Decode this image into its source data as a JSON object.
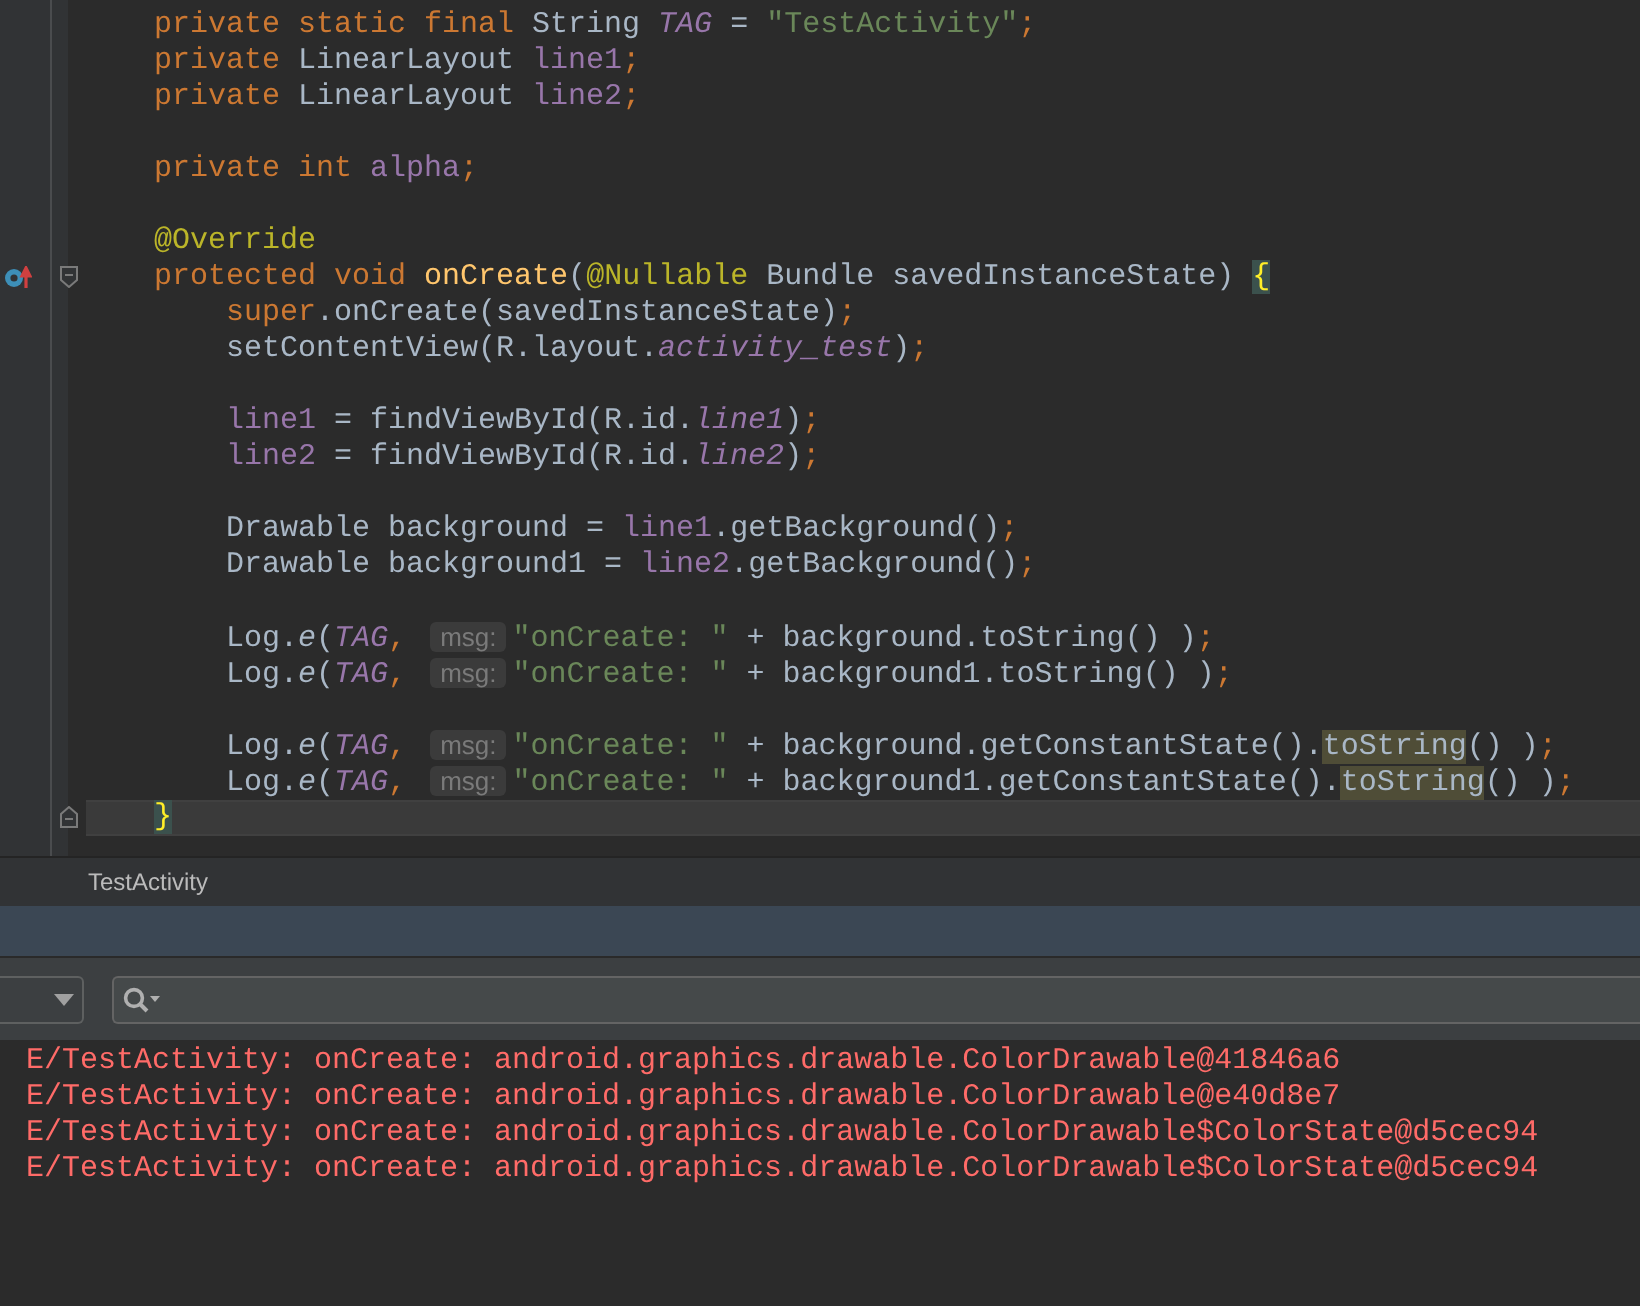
{
  "editor": {
    "lines": [
      {
        "kind": "code",
        "current": false,
        "tokens": [
          {
            "kind": "kw",
            "text": "private static final "
          },
          {
            "kind": "plain",
            "text": "String "
          },
          {
            "kind": "static",
            "text": "TAG"
          },
          {
            "kind": "plain",
            "text": " = "
          },
          {
            "kind": "str",
            "text": "\"TestActivity\""
          },
          {
            "kind": "kw",
            "text": ";"
          }
        ]
      },
      {
        "kind": "code",
        "current": false,
        "tokens": [
          {
            "kind": "kw",
            "text": "private "
          },
          {
            "kind": "plain",
            "text": "LinearLayout "
          },
          {
            "kind": "field",
            "text": "line1"
          },
          {
            "kind": "kw",
            "text": ";"
          }
        ]
      },
      {
        "kind": "code",
        "current": false,
        "tokens": [
          {
            "kind": "kw",
            "text": "private "
          },
          {
            "kind": "plain",
            "text": "LinearLayout "
          },
          {
            "kind": "field",
            "text": "line2"
          },
          {
            "kind": "kw",
            "text": ";"
          }
        ]
      },
      {
        "kind": "blank",
        "current": false
      },
      {
        "kind": "code",
        "current": false,
        "tokens": [
          {
            "kind": "kw",
            "text": "private int "
          },
          {
            "kind": "field",
            "text": "alpha"
          },
          {
            "kind": "kw",
            "text": ";"
          }
        ]
      },
      {
        "kind": "blank",
        "current": false
      },
      {
        "kind": "code",
        "current": false,
        "tokens": [
          {
            "kind": "ann",
            "text": "@Override"
          }
        ]
      },
      {
        "kind": "method_start",
        "current": false,
        "tokens": [
          {
            "kind": "kw",
            "text": "protected void "
          },
          {
            "kind": "decl",
            "text": "onCreate"
          },
          {
            "kind": "plain",
            "text": "("
          },
          {
            "kind": "ann",
            "text": "@Nullable"
          },
          {
            "kind": "plain",
            "text": " Bundle savedInstanceState) "
          },
          {
            "kind": "brace",
            "text": "{"
          }
        ]
      },
      {
        "kind": "code",
        "current": false,
        "tokens": [
          {
            "kind": "kw",
            "text": "    super"
          },
          {
            "kind": "plain",
            "text": ".onCreate(savedInstanceState)"
          },
          {
            "kind": "kw",
            "text": ";"
          }
        ]
      },
      {
        "kind": "code",
        "current": false,
        "tokens": [
          {
            "kind": "plain",
            "text": "    setContentView(R.layout."
          },
          {
            "kind": "static",
            "text": "activity_test"
          },
          {
            "kind": "plain",
            "text": ")"
          },
          {
            "kind": "kw",
            "text": ";"
          }
        ]
      },
      {
        "kind": "blank",
        "current": false
      },
      {
        "kind": "code",
        "current": false,
        "tokens": [
          {
            "kind": "field",
            "text": "    line1"
          },
          {
            "kind": "plain",
            "text": " = findViewById(R.id."
          },
          {
            "kind": "static",
            "text": "line1"
          },
          {
            "kind": "plain",
            "text": ")"
          },
          {
            "kind": "kw",
            "text": ";"
          }
        ]
      },
      {
        "kind": "code",
        "current": false,
        "tokens": [
          {
            "kind": "field",
            "text": "    line2"
          },
          {
            "kind": "plain",
            "text": " = findViewById(R.id."
          },
          {
            "kind": "static",
            "text": "line2"
          },
          {
            "kind": "plain",
            "text": ")"
          },
          {
            "kind": "kw",
            "text": ";"
          }
        ]
      },
      {
        "kind": "blank",
        "current": false
      },
      {
        "kind": "code",
        "current": false,
        "tokens": [
          {
            "kind": "plain",
            "text": "    Drawable background = "
          },
          {
            "kind": "field",
            "text": "line1"
          },
          {
            "kind": "plain",
            "text": ".getBackground()"
          },
          {
            "kind": "kw",
            "text": ";"
          }
        ]
      },
      {
        "kind": "code",
        "current": false,
        "tokens": [
          {
            "kind": "plain",
            "text": "    Drawable background1 = "
          },
          {
            "kind": "field",
            "text": "line2"
          },
          {
            "kind": "plain",
            "text": ".getBackground()"
          },
          {
            "kind": "kw",
            "text": ";"
          }
        ]
      },
      {
        "kind": "blank",
        "current": false
      },
      {
        "kind": "code",
        "current": false,
        "tokens": [
          {
            "kind": "plain",
            "text": "    Log."
          },
          {
            "kind": "smethod",
            "text": "e"
          },
          {
            "kind": "plain",
            "text": "("
          },
          {
            "kind": "static",
            "text": "TAG"
          },
          {
            "kind": "kw",
            "text": ","
          },
          {
            "kind": "hint",
            "text": "msg:"
          },
          {
            "kind": "str",
            "text": "\"onCreate: \""
          },
          {
            "kind": "plain",
            "text": " + background.toString() )"
          },
          {
            "kind": "kw",
            "text": ";"
          }
        ]
      },
      {
        "kind": "code",
        "current": false,
        "tokens": [
          {
            "kind": "plain",
            "text": "    Log."
          },
          {
            "kind": "smethod",
            "text": "e"
          },
          {
            "kind": "plain",
            "text": "("
          },
          {
            "kind": "static",
            "text": "TAG"
          },
          {
            "kind": "kw",
            "text": ","
          },
          {
            "kind": "hint",
            "text": "msg:"
          },
          {
            "kind": "str",
            "text": "\"onCreate: \""
          },
          {
            "kind": "plain",
            "text": " + background1.toString() )"
          },
          {
            "kind": "kw",
            "text": ";"
          }
        ]
      },
      {
        "kind": "blank",
        "current": false
      },
      {
        "kind": "code",
        "current": false,
        "tokens": [
          {
            "kind": "plain",
            "text": "    Log."
          },
          {
            "kind": "smethod",
            "text": "e"
          },
          {
            "kind": "plain",
            "text": "("
          },
          {
            "kind": "static",
            "text": "TAG"
          },
          {
            "kind": "kw",
            "text": ","
          },
          {
            "kind": "hint",
            "text": "msg:"
          },
          {
            "kind": "str",
            "text": "\"onCreate: \""
          },
          {
            "kind": "plain",
            "text": " + background.getConstantState()."
          },
          {
            "kind": "match",
            "text": "toString"
          },
          {
            "kind": "plain",
            "text": "() )"
          },
          {
            "kind": "kw",
            "text": ";"
          }
        ]
      },
      {
        "kind": "code",
        "current": false,
        "tokens": [
          {
            "kind": "plain",
            "text": "    Log."
          },
          {
            "kind": "smethod",
            "text": "e"
          },
          {
            "kind": "plain",
            "text": "("
          },
          {
            "kind": "static",
            "text": "TAG"
          },
          {
            "kind": "kw",
            "text": ","
          },
          {
            "kind": "hint",
            "text": "msg:"
          },
          {
            "kind": "str",
            "text": "\"onCreate: \""
          },
          {
            "kind": "plain",
            "text": " + background1.getConstantState()."
          },
          {
            "kind": "match",
            "text": "toString"
          },
          {
            "kind": "plain",
            "text": "() )"
          },
          {
            "kind": "kw",
            "text": ";"
          }
        ]
      },
      {
        "kind": "block_end",
        "current": true,
        "tokens": [
          {
            "kind": "brace",
            "text": "}"
          }
        ]
      }
    ]
  },
  "file_tab": {
    "label": "TestActivity"
  },
  "logcat": {
    "lines": [
      {
        "kind": "error",
        "text": "E/TestActivity: onCreate: android.graphics.drawable.ColorDrawable@41846a6"
      },
      {
        "kind": "error",
        "text": "E/TestActivity: onCreate: android.graphics.drawable.ColorDrawable@e40d8e7"
      },
      {
        "kind": "error",
        "text": "E/TestActivity: onCreate: android.graphics.drawable.ColorDrawable$ColorState@d5cec94"
      },
      {
        "kind": "error",
        "text": "E/TestActivity: onCreate: android.graphics.drawable.ColorDrawable$ColorState@d5cec94"
      }
    ]
  }
}
